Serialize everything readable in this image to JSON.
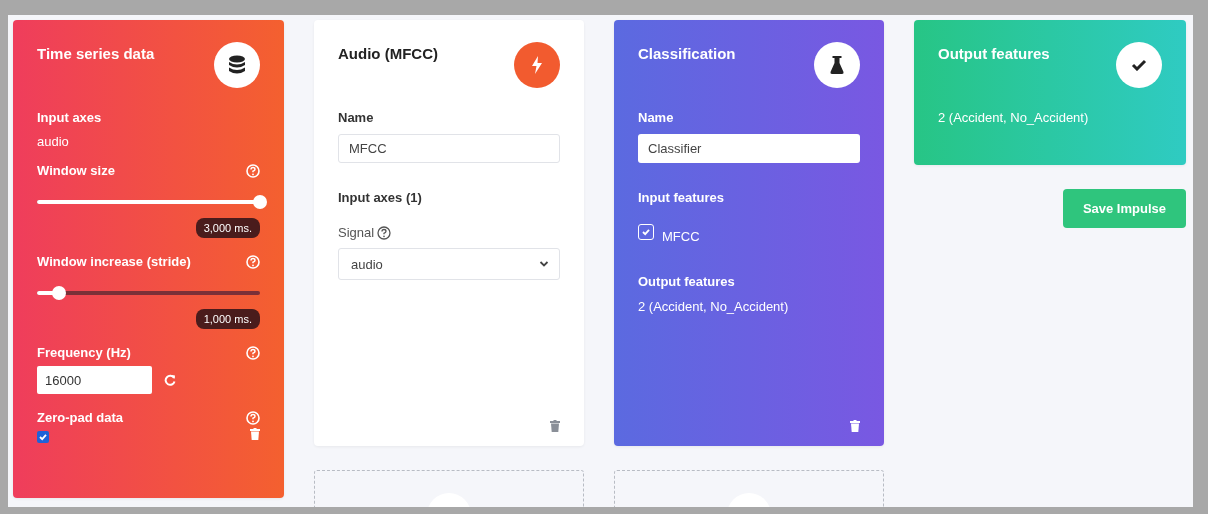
{
  "time_series": {
    "title": "Time series data",
    "axes_label": "Input axes",
    "axes_value": "audio",
    "sliders": [
      {
        "label": "Window size",
        "level": 1,
        "reading": "3,000 ms."
      },
      {
        "label": "Window increase (stride)",
        "level": 0.1,
        "reading": "1,000 ms."
      }
    ],
    "frequency_label": "Frequency (Hz)",
    "frequency_value": "16000",
    "zero_pad_label": "Zero-pad data",
    "zero_pad_checked": true
  },
  "processing": {
    "title": "Audio (MFCC)",
    "name_label": "Name",
    "name_value": "MFCC",
    "axes_label": "Input axes (1)",
    "signal_label": "Signal",
    "signal_value": "audio",
    "add_slot": true
  },
  "learning": {
    "title": "Classification",
    "name_label": "Name",
    "name_value": "Classifier",
    "input_label": "Input features",
    "features": [
      {
        "label": "MFCC",
        "checked": true
      }
    ],
    "output_label": "Output features",
    "output_value": "2 (Accident, No_Accident)",
    "add_slot": true
  },
  "output": {
    "title": "Output features",
    "value": "2 (Accident, No_Accident)"
  },
  "save_button": "Save Impulse"
}
